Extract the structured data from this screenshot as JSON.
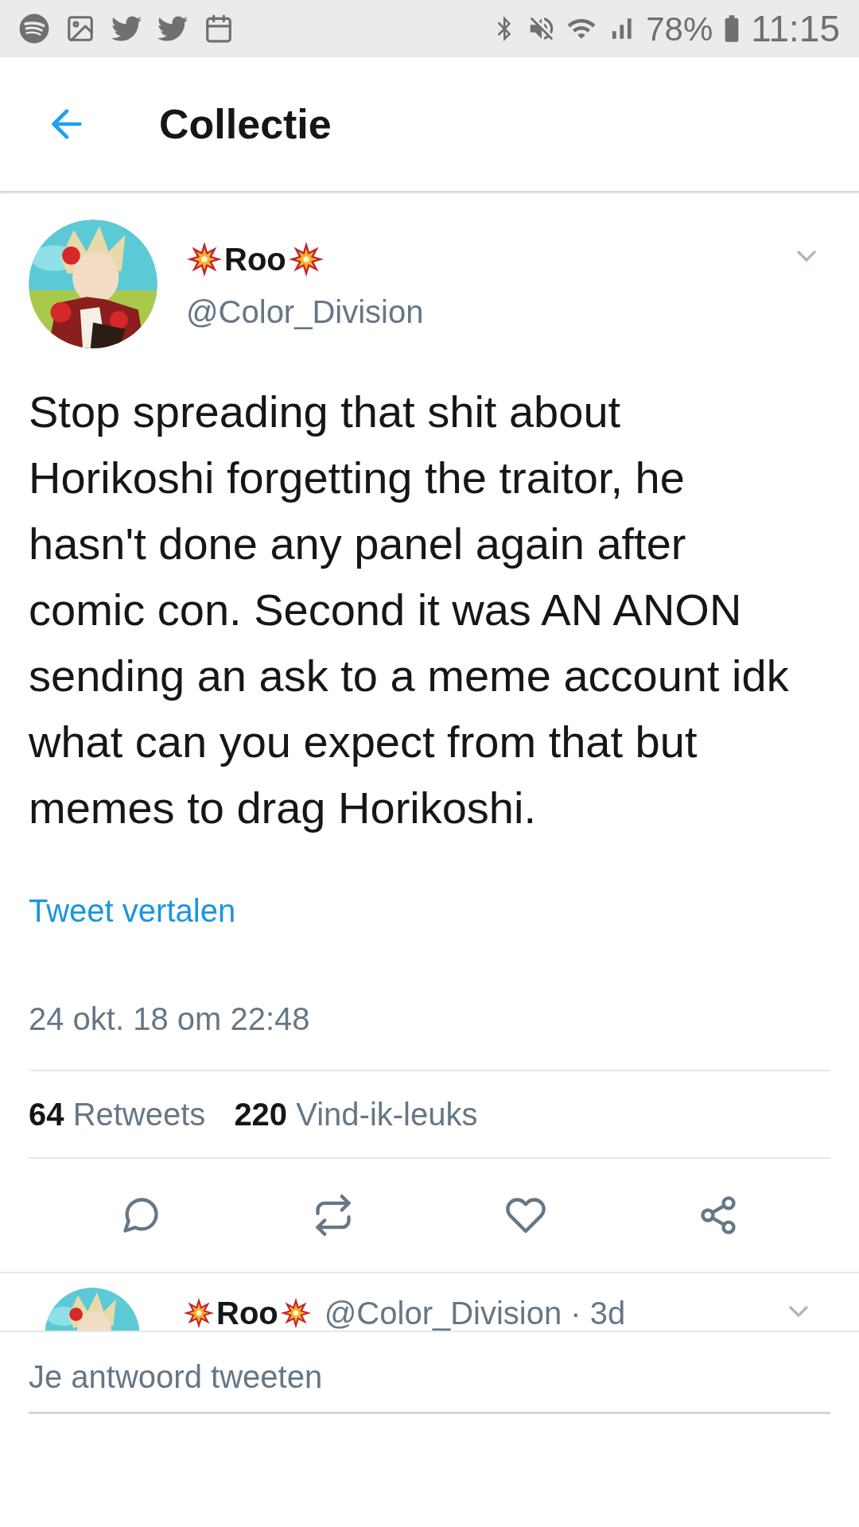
{
  "status_bar": {
    "battery": "78%",
    "time": "11:15"
  },
  "header": {
    "title": "Collectie"
  },
  "tweet": {
    "name": "Roo",
    "handle": "@Color_Division",
    "text": "Stop spreading that shit about Horikoshi forgetting the traitor, he hasn't done any panel again after comic con. Second it was AN ANON sending an ask to a meme account idk what can you expect from that but memes to drag Horikoshi.",
    "translate": "Tweet vertalen",
    "date": "24 okt. 18 om 22:48",
    "retweets": {
      "count": "64",
      "label": "Retweets"
    },
    "likes": {
      "count": "220",
      "label": "Vind-ik-leuks"
    }
  },
  "reply_preview": {
    "name": "Roo",
    "meta": "@Color_Division · 3d"
  },
  "composer": {
    "placeholder": "Je antwoord tweeten"
  }
}
